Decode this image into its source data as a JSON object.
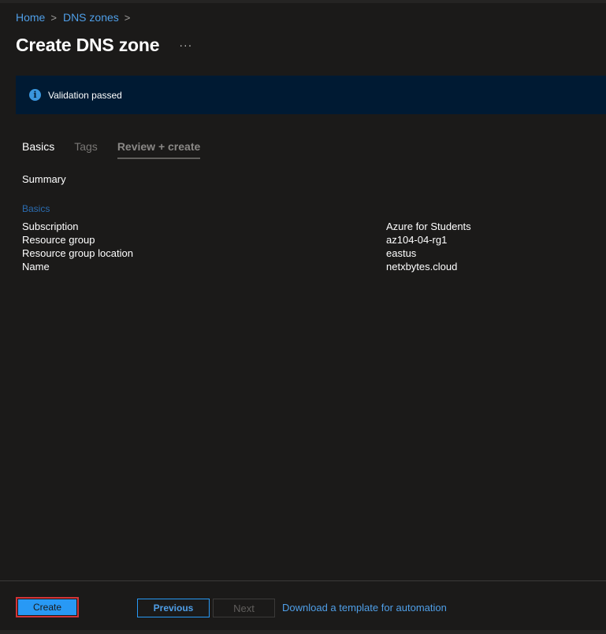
{
  "breadcrumb": {
    "items": [
      "Home",
      "DNS zones"
    ],
    "separator": ">"
  },
  "page": {
    "title": "Create DNS zone",
    "more_label": "···"
  },
  "banner": {
    "icon": "info-icon",
    "icon_glyph": "i",
    "text": "Validation passed",
    "background": "#001a33"
  },
  "tabs": [
    {
      "label": "Basics",
      "state": "active"
    },
    {
      "label": "Tags",
      "state": "disabled"
    },
    {
      "label": "Review + create",
      "state": "current"
    }
  ],
  "summary": {
    "label": "Summary",
    "section_heading": "Basics",
    "rows": [
      {
        "key": "Subscription",
        "value": "Azure for Students"
      },
      {
        "key": "Resource group",
        "value": "az104-04-rg1"
      },
      {
        "key": "Resource group location",
        "value": "eastus"
      },
      {
        "key": "Name",
        "value": "netxbytes.cloud"
      }
    ]
  },
  "footer": {
    "create_label": "Create",
    "previous_label": "Previous",
    "next_label": "Next",
    "download_link": "Download a template for automation"
  },
  "colors": {
    "accent": "#2899f5",
    "link": "#4f9fe8",
    "highlight_border": "#d13438",
    "background": "#1b1a19"
  }
}
